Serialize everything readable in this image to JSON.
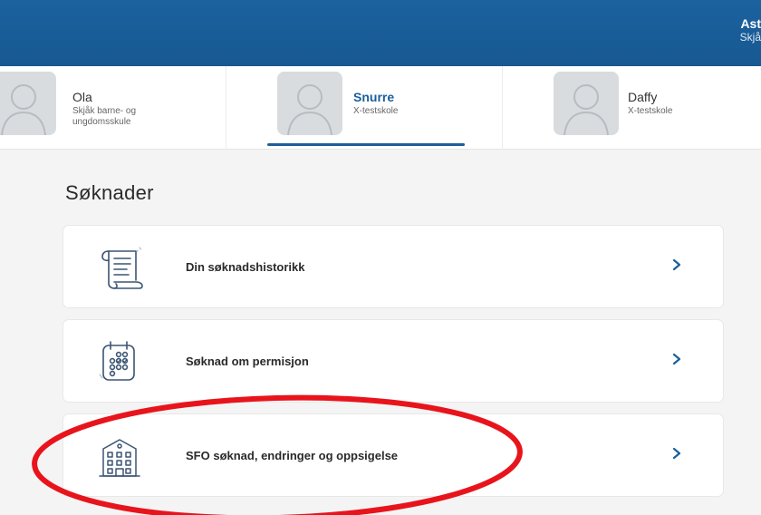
{
  "header": {
    "user_name": "Ast",
    "user_school": "Skjå"
  },
  "children": [
    {
      "name": "Ola",
      "school": "Skjåk barne- og ungdomsskule",
      "active": false
    },
    {
      "name": "Snurre",
      "school": "X-testskole",
      "active": true
    },
    {
      "name": "Daffy",
      "school": "X-testskole",
      "active": false
    }
  ],
  "section": {
    "title": "Søknader"
  },
  "cards": [
    {
      "label": "Din søknadshistorikk",
      "icon": "scroll-icon"
    },
    {
      "label": "Søknad om permisjon",
      "icon": "calendar-icon"
    },
    {
      "label": "SFO søknad, endringer og oppsigelse",
      "icon": "school-building-icon"
    }
  ],
  "colors": {
    "header_blue": "#1a5f9c",
    "accent": "#1a5f9c",
    "annotation": "#e8141c"
  }
}
